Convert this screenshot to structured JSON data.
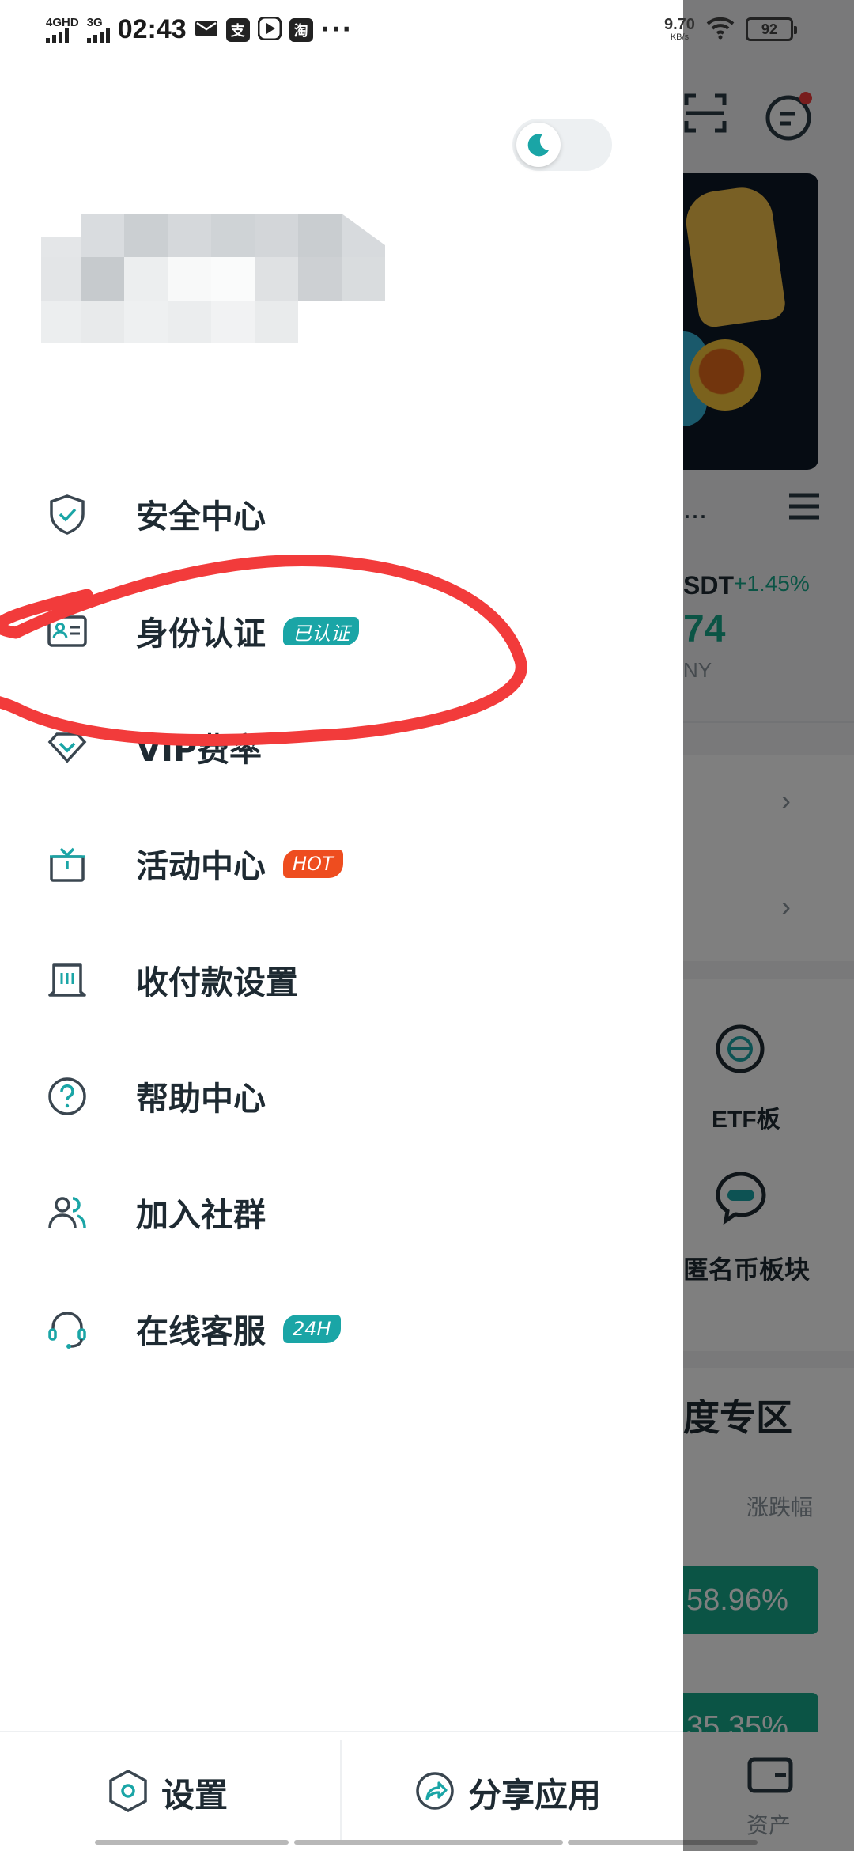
{
  "status_bar": {
    "network1": "4GHD",
    "network2": "3G",
    "time": "02:43",
    "notif_icons": [
      "mail-icon",
      "alipay-icon",
      "play-icon",
      "taobao-icon"
    ],
    "notif_text": {
      "alipay": "支",
      "taobao": "淘"
    },
    "more": "···",
    "net_speed": "9.70",
    "net_unit": "KB/s",
    "battery": "92"
  },
  "drawer": {
    "menu": [
      {
        "label": "安全中心",
        "icon": "shield-check-icon"
      },
      {
        "label": "身份认证",
        "icon": "id-card-icon",
        "badge": "已认证",
        "badge_color": "#1aa5a6"
      },
      {
        "label": "VIP费率",
        "icon": "diamond-icon"
      },
      {
        "label": "活动中心",
        "icon": "gift-icon",
        "badge": "HOT",
        "badge_color": "#ee4d1f"
      },
      {
        "label": "收付款设置",
        "icon": "payment-icon"
      },
      {
        "label": "帮助中心",
        "icon": "help-icon"
      },
      {
        "label": "加入社群",
        "icon": "community-icon"
      },
      {
        "label": "在线客服",
        "icon": "headset-icon",
        "badge": "24H",
        "badge_color": "#1aa5a6"
      }
    ],
    "bottom": {
      "settings": "设置",
      "share": "分享应用"
    },
    "accent": "#1aa5a6",
    "annotation_color": "#f23b3b"
  },
  "background": {
    "ticker_label": "SDT",
    "ticker_change": "+1.45%",
    "ticker_price": "74",
    "ticker_currency": "NY",
    "truncated_title": "...",
    "etf_label": "ETF板",
    "anon_label": "匿名币板块",
    "zone_title": "度专区",
    "sort_label": "涨跌幅",
    "pct1": "58.96%",
    "pct2": "35.35%",
    "assets_label": "资产"
  }
}
